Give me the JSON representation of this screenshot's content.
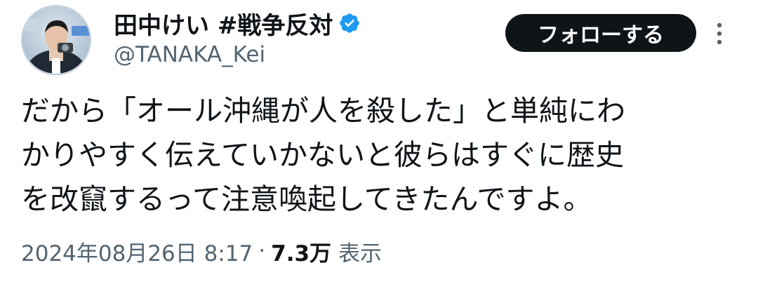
{
  "tweet": {
    "author": {
      "display_name": "田中けい #戦争反対",
      "handle": "@TANAKA_Kei",
      "verified": true,
      "verified_color": "#1d9bf0",
      "avatar": "avatar-photo"
    },
    "follow_button": {
      "label": "フォローする",
      "background": "#0f1419"
    },
    "more_menu": {
      "icon": "more-vertical-icon"
    },
    "text_lines": [
      "だから「オール沖縄が人を殺した」と単純にわ",
      "かりやすく伝えていかないと彼らはすぐに歴史",
      "を改竄するって注意喚起してきたんですよ。"
    ],
    "timestamp": "2024年08月26日 8:17",
    "separator": "·",
    "views": {
      "count": "7.3万",
      "label": "表示"
    }
  }
}
